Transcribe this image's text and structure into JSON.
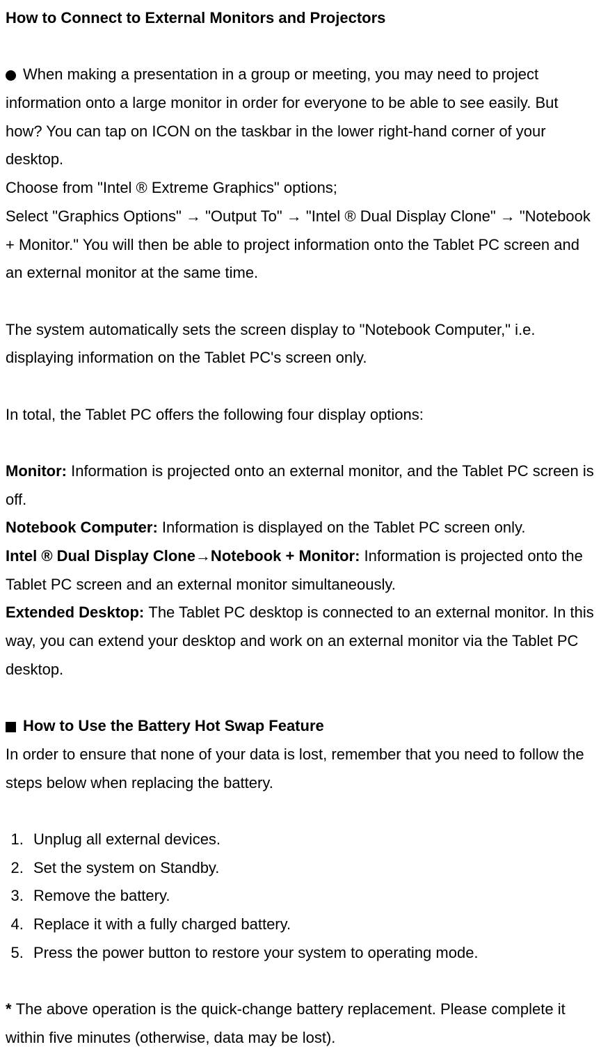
{
  "title": "How to Connect to External Monitors and Projectors",
  "intro1": "When making a presentation in a group or meeting, you may need to project information onto a large monitor in order for everyone to be able to see easily.    But how? You can tap on ICON on the taskbar in the lower right-hand corner of your desktop.",
  "choose": "Choose from \"Intel ® Extreme Graphics\" options;",
  "select": "Select \"Graphics Options\" → \"Output To\" → \"Intel ® Dual Display Clone\" → \"Notebook + Monitor.\"    You will then be able to project information onto the Tablet PC screen and an external monitor at the same time.",
  "auto": "The system automatically sets the screen display to \"Notebook Computer,\" i.e. displaying information on the Tablet PC's screen only.",
  "total": "In total, the Tablet PC offers the following four display options:",
  "opt1_label": "Monitor: ",
  "opt1_text": "Information is projected onto an external monitor, and the Tablet PC screen is off.",
  "opt2_label": "Notebook Computer: ",
  "opt2_text": "Information is displayed on the Tablet PC screen only.",
  "opt3_label": "Intel ® Dual Display Clone→Notebook + Monitor: ",
  "opt3_text": "Information is projected onto the Tablet PC screen and an external monitor simultaneously.",
  "opt4_label": "Extended Desktop: ",
  "opt4_text": "The Tablet PC desktop is connected to an external monitor.    In this way, you can extend your desktop and work on an external monitor via the Tablet PC desktop.",
  "battery_title": "How to Use the Battery Hot Swap Feature",
  "battery_intro": "In order to ensure that none of your data is lost, remember that you need to follow the steps below when replacing the battery.",
  "steps": {
    "s1": "Unplug all external devices.",
    "s2": "Set the system on Standby.",
    "s3": "Remove the battery.",
    "s4": "Replace it with a fully charged battery.",
    "s5": "Press the power button to restore your system to operating mode."
  },
  "note_star": "* ",
  "note_text": "The above operation is the quick-change battery replacement.    Please complete it within five minutes (otherwise, data may be lost)."
}
